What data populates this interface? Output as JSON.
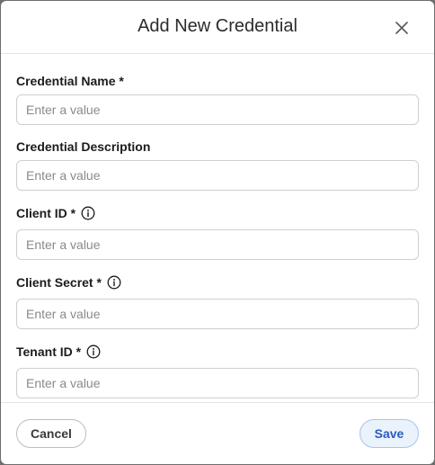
{
  "dialog": {
    "title": "Add New Credential"
  },
  "fields": [
    {
      "label": "Credential Name *",
      "placeholder": "Enter a value",
      "value": ""
    },
    {
      "label": "Credential Description",
      "placeholder": "Enter a value",
      "value": ""
    },
    {
      "label": "Client ID *",
      "placeholder": "Enter a value",
      "value": "",
      "info_icon": "info-icon"
    },
    {
      "label": "Client Secret *",
      "placeholder": "Enter a value",
      "value": "",
      "info_icon": "info-icon"
    },
    {
      "label": "Tenant ID *",
      "placeholder": "Enter a value",
      "value": "",
      "info_icon": "info-icon"
    }
  ],
  "footer": {
    "cancel_label": "Cancel",
    "save_label": "Save"
  },
  "icons": {
    "close": "close-icon",
    "info": "info-icon"
  },
  "colors": {
    "save_bg": "#eaf2fc",
    "save_text": "#2a5bbf",
    "backdrop": "#6e6e6e"
  }
}
